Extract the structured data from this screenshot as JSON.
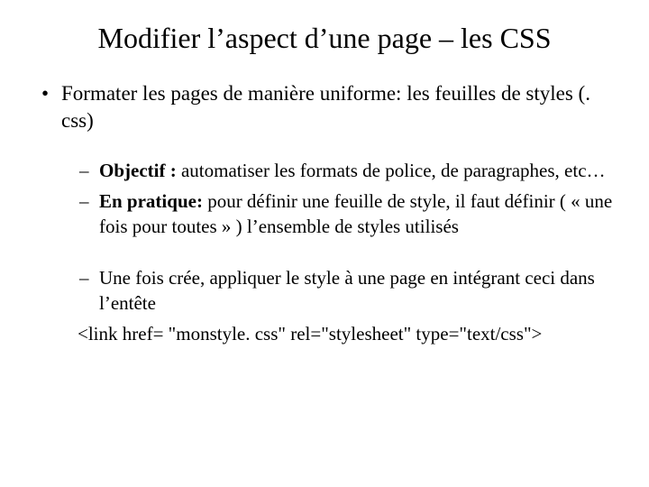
{
  "title": "Modifier l’aspect d’une page – les CSS",
  "bullet1": "Formater les pages de manière uniforme: les feuilles de styles (. css)",
  "sub1_bold": "Objectif :",
  "sub1_rest": " automatiser les formats de police, de paragraphes, etc…",
  "sub2_bold": "En pratique:",
  "sub2_rest": " pour définir une feuille de style, il faut définir ( « une fois pour toutes » ) l’ensemble de styles utilisés",
  "sub3": "Une fois crée, appliquer le style à une page en intégrant ceci dans l’entête",
  "codeline": "<link href= \"monstyle. css\" rel=\"stylesheet\" type=\"text/css\">"
}
